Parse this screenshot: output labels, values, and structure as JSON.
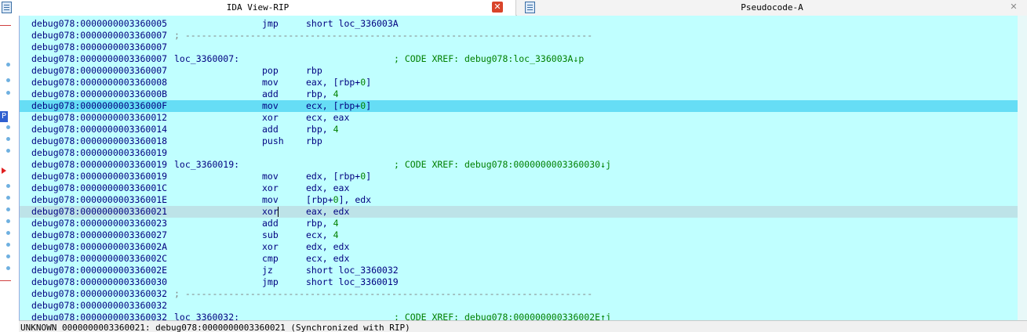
{
  "tabs": [
    {
      "title": "IDA View-RIP",
      "icon": "disassembly-view-icon",
      "active": true
    },
    {
      "title": "Pseudocode-A",
      "icon": "pseudocode-view-icon",
      "active": false
    }
  ],
  "status": "UNKNOWN 0000000003360021: debug078:0000000003360021 (Synchronized with RIP)",
  "listing": [
    {
      "addr": "debug078:0000000003360005",
      "kind": "ins",
      "mn": "jmp",
      "op": "short loc_336003A"
    },
    {
      "addr": "debug078:0000000003360007",
      "kind": "sep",
      "text": "; ---------------------------------------------------------------------------"
    },
    {
      "addr": "debug078:0000000003360007",
      "kind": "blank"
    },
    {
      "addr": "debug078:0000000003360007",
      "kind": "label",
      "label": "loc_3360007:",
      "comment": "; CODE XREF: debug078:loc_336003A↓p"
    },
    {
      "addr": "debug078:0000000003360007",
      "kind": "ins",
      "mn": "pop",
      "op": "rbp"
    },
    {
      "addr": "debug078:0000000003360008",
      "kind": "ins",
      "mn": "mov",
      "op": "eax, [rbp+0]",
      "num": "0"
    },
    {
      "addr": "debug078:000000000336000B",
      "kind": "ins",
      "mn": "add",
      "op": "rbp, 4",
      "num": "4"
    },
    {
      "addr": "debug078:000000000336000F",
      "kind": "ins",
      "mn": "mov",
      "op": "ecx, [rbp+0]",
      "num": "0",
      "selected": true
    },
    {
      "addr": "debug078:0000000003360012",
      "kind": "ins",
      "mn": "xor",
      "op": "ecx, eax"
    },
    {
      "addr": "debug078:0000000003360014",
      "kind": "ins",
      "mn": "add",
      "op": "rbp, 4",
      "num": "4"
    },
    {
      "addr": "debug078:0000000003360018",
      "kind": "ins",
      "mn": "push",
      "op": "rbp"
    },
    {
      "addr": "debug078:0000000003360019",
      "kind": "blank"
    },
    {
      "addr": "debug078:0000000003360019",
      "kind": "label",
      "label": "loc_3360019:",
      "comment": "; CODE XREF: debug078:0000000003360030↓j"
    },
    {
      "addr": "debug078:0000000003360019",
      "kind": "ins",
      "mn": "mov",
      "op": "edx, [rbp+0]",
      "num": "0"
    },
    {
      "addr": "debug078:000000000336001C",
      "kind": "ins",
      "mn": "xor",
      "op": "edx, eax"
    },
    {
      "addr": "debug078:000000000336001E",
      "kind": "ins",
      "mn": "mov",
      "op": "[rbp+0], edx",
      "num": "0"
    },
    {
      "addr": "debug078:0000000003360021",
      "kind": "ins",
      "mn": "xor",
      "op": "eax, edx",
      "current": true
    },
    {
      "addr": "debug078:0000000003360023",
      "kind": "ins",
      "mn": "add",
      "op": "rbp, 4",
      "num": "4"
    },
    {
      "addr": "debug078:0000000003360027",
      "kind": "ins",
      "mn": "sub",
      "op": "ecx, 4",
      "num": "4"
    },
    {
      "addr": "debug078:000000000336002A",
      "kind": "ins",
      "mn": "xor",
      "op": "edx, edx"
    },
    {
      "addr": "debug078:000000000336002C",
      "kind": "ins",
      "mn": "cmp",
      "op": "ecx, edx"
    },
    {
      "addr": "debug078:000000000336002E",
      "kind": "ins",
      "mn": "jz",
      "op": "short loc_3360032"
    },
    {
      "addr": "debug078:0000000003360030",
      "kind": "ins",
      "mn": "jmp",
      "op": "short loc_3360019"
    },
    {
      "addr": "debug078:0000000003360032",
      "kind": "sep",
      "text": "; ---------------------------------------------------------------------------"
    },
    {
      "addr": "debug078:0000000003360032",
      "kind": "blank"
    },
    {
      "addr": "debug078:0000000003360032",
      "kind": "label",
      "label": "loc_3360032:",
      "comment": "; CODE XREF: debug078:000000000336002E↑j"
    }
  ]
}
